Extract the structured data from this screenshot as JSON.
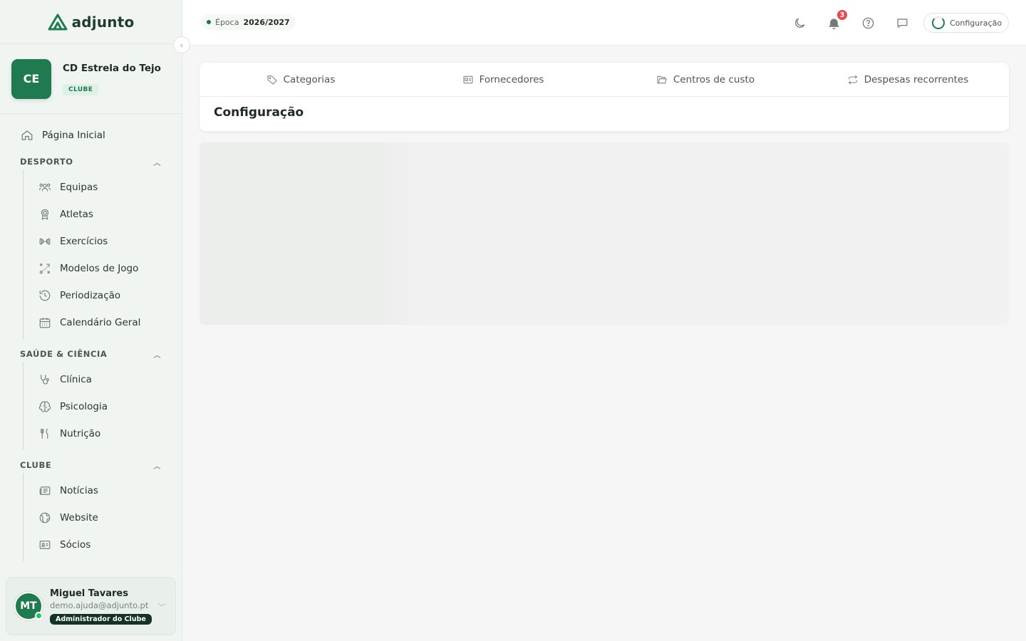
{
  "brand": {
    "name": "adjunto"
  },
  "club": {
    "initials": "CE",
    "name": "CD Estrela do Tejo",
    "badge": "CLUBE"
  },
  "nav": {
    "home": {
      "label": "Página Inicial",
      "icon": "home-icon"
    },
    "sections": [
      {
        "title": "DESPORTO",
        "items": [
          {
            "label": "Equipas",
            "icon": "users-icon"
          },
          {
            "label": "Atletas",
            "icon": "medal-icon"
          },
          {
            "label": "Exercícios",
            "icon": "dumbbell-icon"
          },
          {
            "label": "Modelos de Jogo",
            "icon": "tactics-icon"
          },
          {
            "label": "Periodização",
            "icon": "history-icon"
          },
          {
            "label": "Calendário Geral",
            "icon": "calendar-icon"
          }
        ]
      },
      {
        "title": "SAÚDE & CIÊNCIA",
        "items": [
          {
            "label": "Clínica",
            "icon": "stethoscope-icon"
          },
          {
            "label": "Psicologia",
            "icon": "brain-icon"
          },
          {
            "label": "Nutrição",
            "icon": "utensils-icon"
          }
        ]
      },
      {
        "title": "CLUBE",
        "items": [
          {
            "label": "Notícias",
            "icon": "newspaper-icon"
          },
          {
            "label": "Website",
            "icon": "globe-icon"
          },
          {
            "label": "Sócios",
            "icon": "id-card-icon"
          }
        ]
      }
    ]
  },
  "user": {
    "initials": "MT",
    "name": "Miguel Tavares",
    "email": "demo.ajuda@adjunto.pt",
    "role": "Administrador do Clube"
  },
  "topbar": {
    "season_label": "Época",
    "season_value": "2026/2027",
    "notifications_count": "3",
    "config_label": "Configuração"
  },
  "main": {
    "tabs": [
      {
        "label": "Categorias",
        "icon": "tag-icon"
      },
      {
        "label": "Fornecedores",
        "icon": "vendor-card-icon"
      },
      {
        "label": "Centros de custo",
        "icon": "folder-icon"
      },
      {
        "label": "Despesas recorrentes",
        "icon": "repeat-icon"
      }
    ],
    "title": "Configuração"
  },
  "colors": {
    "accent": "#1f7a4f",
    "badge_red": "#e5484d",
    "sidebar_bg": "#f1f5f2"
  }
}
